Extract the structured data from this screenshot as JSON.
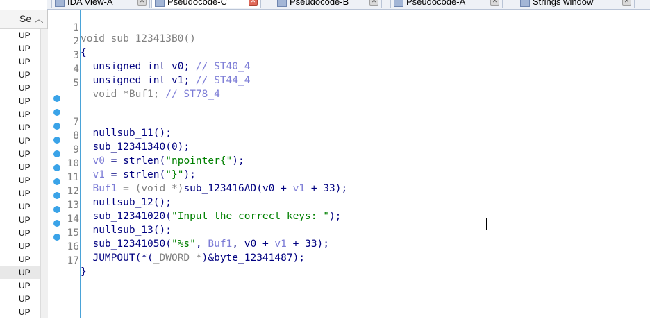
{
  "tabs": [
    {
      "label": "IDA View-A",
      "active": false
    },
    {
      "label": "Pseudocode-C",
      "active": true
    },
    {
      "label": "Pseudocode-B",
      "active": false
    },
    {
      "label": "Pseudocode-A",
      "active": false
    },
    {
      "label": "Strings window",
      "active": false
    }
  ],
  "functions_panel": {
    "header": "Se",
    "items": [
      "UP",
      "UP",
      "UP",
      "UP",
      "UP",
      "UP",
      "UP",
      "UP",
      "UP",
      "UP",
      "UP",
      "UP",
      "UP",
      "UP",
      "UP",
      "UP",
      "UP",
      "UP",
      "UP",
      "UP",
      "UP",
      "UP"
    ],
    "selected_index": 18
  },
  "code": {
    "function_signature": "void sub_123413B0()",
    "open_brace": "{",
    "close_brace": "}",
    "lines": {
      "l3_type": "unsigned int",
      "l3_var": "v0",
      "l3_comment": "// ST40_4",
      "l4_type": "unsigned int",
      "l4_var": "v1",
      "l4_comment": "// ST44_4",
      "l5_decl": "void *Buf1;",
      "l5_comment": "// ST78_4",
      "l7": "nullsub_11();",
      "l8": "sub_12341340(0);",
      "l9_var": "v0",
      "l9_call": "strlen(",
      "l9_str": "\"npointer{\"",
      "l9_end": ");",
      "l10_var": "v1",
      "l10_call": "strlen(",
      "l10_str": "\"}\"",
      "l10_end": ");",
      "l11_var": "Buf1",
      "l11_cast": "= (void *)",
      "l11_call": "sub_123416AD(",
      "l11_a": "v0",
      "l11_b": "v1",
      "l11_c": "+ 33);",
      "l12": "nullsub_12();",
      "l13_call": "sub_12341020(",
      "l13_str": "\"Input the correct keys: \"",
      "l13_end": ");",
      "l14": "nullsub_13();",
      "l15_call": "sub_12341050(",
      "l15_str": "\"%s\"",
      "l15_a": "Buf1",
      "l15_b": "v0",
      "l15_c": "v1",
      "l15_end": "+ 33);",
      "l16_a": "JUMPOUT(*(",
      "l16_b": "_DWORD *",
      "l16_c": ")&byte_12341487);"
    },
    "line_numbers": [
      "1",
      "2",
      "3",
      "4",
      "5",
      "",
      "7",
      "8",
      "9",
      "10",
      "11",
      "12",
      "13",
      "14",
      "15",
      "16",
      "17"
    ]
  },
  "colors": {
    "keyword": "#000080",
    "comment": "#7c7cd6",
    "string": "#008000",
    "breakpoint_dot": "#3aa3e8"
  }
}
